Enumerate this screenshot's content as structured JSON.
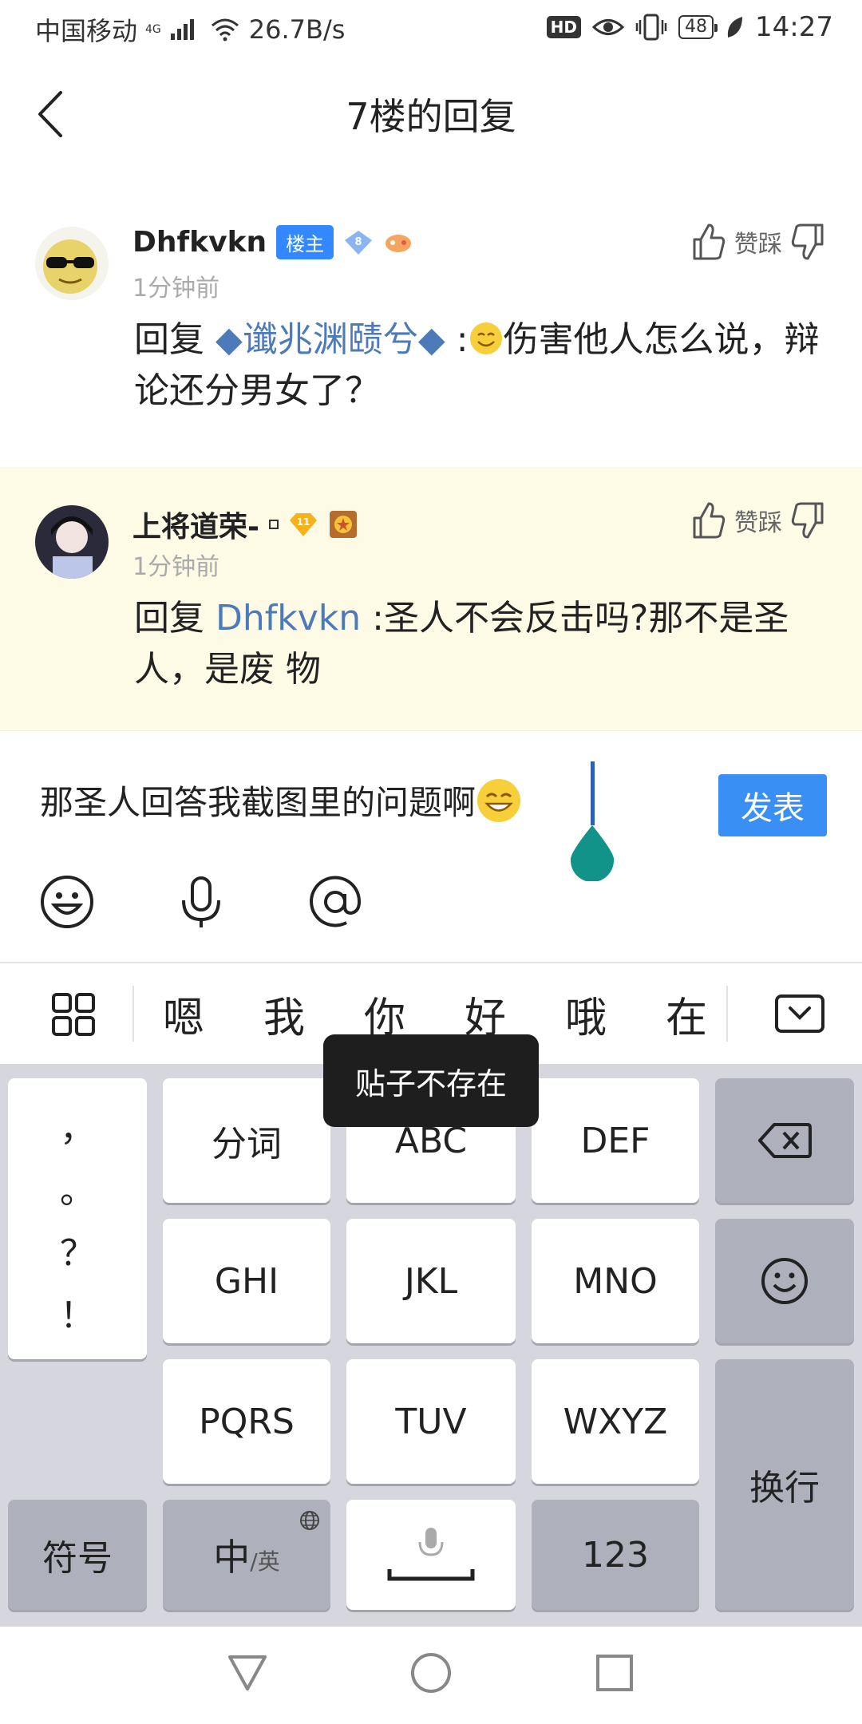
{
  "status_bar": {
    "carrier": "中国移动",
    "network": "4G",
    "speed": "26.7B/s",
    "hd": "HD",
    "battery": "48",
    "time": "14:27"
  },
  "header": {
    "title": "7楼的回复"
  },
  "comments": [
    {
      "username": "Dhfkvkn",
      "owner_badge": "楼主",
      "level": "8",
      "time": "1分钟前",
      "vote_label": "赞踩",
      "reply_prefix": "回复",
      "mention": "◆谶兆渊赜兮◆",
      "text": "伤害他人怎么说，辩论还分男女了？"
    },
    {
      "username": "上将道荣-",
      "level": "11",
      "time": "1分钟前",
      "vote_label": "赞踩",
      "reply_prefix": "回复",
      "mention": "Dhfkvkn",
      "text": "圣人不会反击吗?那不是圣人，是废 物"
    }
  ],
  "composer": {
    "text": "那圣人回答我截图里的问题啊",
    "post_label": "发表"
  },
  "candidates": [
    "嗯",
    "我",
    "你",
    "好",
    "哦",
    "在"
  ],
  "keyboard": {
    "punct": [
      "，",
      "。",
      "？",
      "！"
    ],
    "rows": [
      [
        "分词",
        "ABC",
        "DEF"
      ],
      [
        "GHI",
        "JKL",
        "MNO"
      ],
      [
        "PQRS",
        "TUV",
        "WXYZ"
      ]
    ],
    "symbols": "符号",
    "lang_main": "中",
    "lang_alt": "/英",
    "num": "123",
    "enter": "换行"
  },
  "toast": "贴子不存在",
  "colors": {
    "accent": "#3a8ff4",
    "link": "#4d7ab8",
    "highlight_bg": "#fdfbe6"
  }
}
